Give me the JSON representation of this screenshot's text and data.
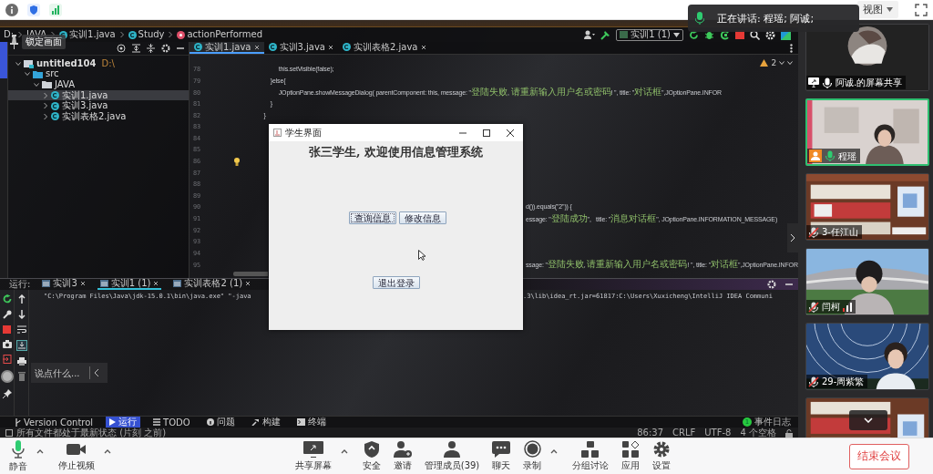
{
  "top_bar": {
    "view_menu": "视图"
  },
  "speaking_toast": {
    "text": "正在讲话: 程瑶; 阿诚;"
  },
  "lock_overlay": {
    "label": "锁定画面"
  },
  "ide": {
    "breadcrumb": [
      {
        "label": "D:",
        "kind": "drive"
      },
      {
        "label": "JAVA",
        "kind": "package"
      },
      {
        "label": "实训1.java",
        "kind": "class"
      },
      {
        "label": "Study",
        "kind": "class"
      },
      {
        "label": "actionPerformed",
        "kind": "method"
      }
    ],
    "run_config": "实训1 (1)",
    "project_tree": [
      {
        "name": "untitled104",
        "path": "D:\\",
        "kind": "module",
        "expanded": true,
        "selected": false,
        "children": [
          {
            "name": "src",
            "kind": "folder",
            "expanded": true,
            "selected": false,
            "children": [
              {
                "name": "JAVA",
                "kind": "package",
                "expanded": true,
                "selected": false,
                "children": [
                  {
                    "name": "实训1.java",
                    "kind": "class",
                    "expanded": false,
                    "selected": true
                  },
                  {
                    "name": "实训3.java",
                    "kind": "class",
                    "expanded": false,
                    "selected": false
                  },
                  {
                    "name": "实训表格2.java",
                    "kind": "class",
                    "expanded": false,
                    "selected": false
                  }
                ]
              }
            ]
          }
        ]
      }
    ],
    "editor_tabs": [
      {
        "label": "实训1.java",
        "selected": true
      },
      {
        "label": "实训3.java",
        "selected": false
      },
      {
        "label": "实训表格2.java",
        "selected": false
      }
    ],
    "warning_count": "2",
    "code_lines": [
      {
        "number": "78",
        "bulb": false,
        "text": "           this.setVisible(false);"
      },
      {
        "number": "79",
        "bulb": false,
        "text": "      }else{"
      },
      {
        "number": "80",
        "bulb": false,
        "text": "           JOptionPane.showMessageDialog( parentComponent: this, message: \"登陆失败, 请重新输入用户名或密码! \", title: \"对话框\",JOptionPane.INFOR"
      },
      {
        "number": "81",
        "bulb": false,
        "text": "      }"
      },
      {
        "number": "82",
        "bulb": false,
        "text": "  }"
      },
      {
        "number": "83",
        "bulb": false
      },
      {
        "number": "84",
        "bulb": false
      },
      {
        "number": "85",
        "bulb": false
      },
      {
        "number": "86",
        "bulb": true
      },
      {
        "number": "87",
        "bulb": false
      },
      {
        "number": "88",
        "bulb": false
      },
      {
        "number": "89",
        "bulb": false
      },
      {
        "number": "90",
        "bulb": false,
        "tail": "d()).equals(\"2\")) {"
      },
      {
        "number": "91",
        "bulb": false,
        "tail": "essage: \"登陆成功\",   title: \"消息对话框\", JOptionPane.INFORMATION_MESSAGE)"
      },
      {
        "number": "92",
        "bulb": false
      },
      {
        "number": "93",
        "bulb": false
      },
      {
        "number": "94",
        "bulb": false
      },
      {
        "number": "95",
        "bulb": false,
        "tail": "ssage: \"登陆失败, 请重新输入用户名或密码! \", title: \"对话框\",JOptionPane.INFOR"
      }
    ],
    "run_label": "运行:",
    "run_tabs": [
      {
        "label": "实训3",
        "selected": false
      },
      {
        "label": "实训1 (1)",
        "selected": true
      },
      {
        "label": "实训表格2 (1)",
        "selected": false
      }
    ],
    "console": {
      "left": "\"C:\\Program Files\\Java\\jdk-15.0.1\\bin\\java.exe\" \"-java",
      "right": ".3\\lib\\idea_rt.jar=61817:C:\\Users\\Xuxicheng\\IntelliJ IDEA Communi"
    },
    "tool_tabs": [
      {
        "label": "Version Control",
        "kind": "vcs",
        "selected": false
      },
      {
        "label": "运行",
        "kind": "run",
        "selected": true
      },
      {
        "label": "TODO",
        "kind": "todo",
        "selected": false
      },
      {
        "label": "问题",
        "kind": "problems",
        "selected": false
      },
      {
        "label": "构建",
        "kind": "build",
        "selected": false
      },
      {
        "label": "终端",
        "kind": "terminal",
        "selected": false
      }
    ],
    "event_log": {
      "label": "事件日志",
      "count": "1"
    },
    "status_message": "所有文件都处于最新状态 (片刻 之前)",
    "status_items": [
      "86:37",
      "CRLF",
      "UTF-8",
      "4 个空格"
    ]
  },
  "dialog": {
    "title": "学生界面",
    "heading": "张三学生, 欢迎使用信息管理系统",
    "buttons": [
      {
        "label": "查询信息",
        "focused": true
      },
      {
        "label": "修改信息",
        "focused": false
      }
    ],
    "exit_button": "退出登录"
  },
  "chat_overlay": {
    "placeholder": "说点什么..."
  },
  "participants": [
    {
      "name": "阿诚.的屏幕共享",
      "kind": "share",
      "muted": false,
      "speaking": false,
      "active_speaker": false,
      "network_icon": false
    },
    {
      "name": "程瑶",
      "kind": "host",
      "muted": false,
      "speaking": true,
      "active_speaker": true,
      "network_icon": false
    },
    {
      "name": "3-任江山",
      "kind": "member",
      "muted": true,
      "speaking": false,
      "active_speaker": false,
      "network_icon": false
    },
    {
      "name": "闫柯",
      "kind": "member",
      "muted": true,
      "speaking": false,
      "active_speaker": false,
      "network_icon": true
    },
    {
      "name": "29-周紫繁",
      "kind": "member",
      "muted": true,
      "speaking": false,
      "active_speaker": false,
      "network_icon": false
    },
    {
      "kind": "partial"
    }
  ],
  "toolbar": [
    {
      "label": "静音",
      "kind": "mic",
      "menu": true
    },
    {
      "label": "停止视频",
      "kind": "camera",
      "menu": true
    },
    {
      "label": "共享屏幕",
      "kind": "share",
      "menu": true
    },
    {
      "label": "安全",
      "kind": "shield",
      "menu": false
    },
    {
      "label": "邀请",
      "kind": "invite",
      "menu": false
    },
    {
      "label": "管理成员(39)",
      "kind": "members",
      "menu": false
    },
    {
      "label": "聊天",
      "kind": "chat",
      "menu": false
    },
    {
      "label": "录制",
      "kind": "record",
      "menu": true
    },
    {
      "label": "分组讨论",
      "kind": "breakout",
      "menu": false
    },
    {
      "label": "应用",
      "kind": "apps",
      "menu": false
    },
    {
      "label": "设置",
      "kind": "settings",
      "menu": false
    }
  ],
  "end_button": "结束会议"
}
